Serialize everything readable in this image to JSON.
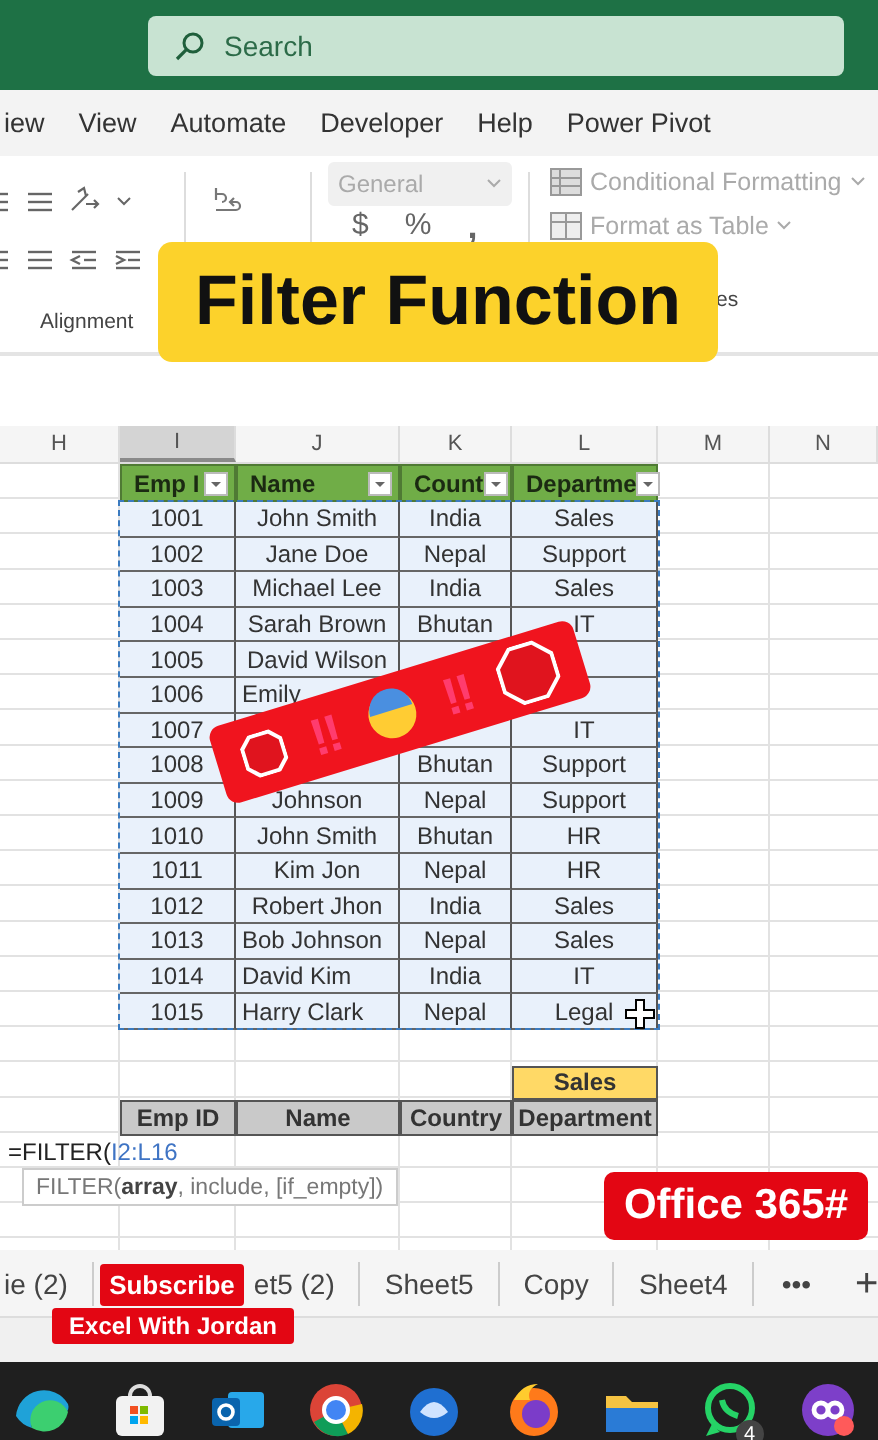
{
  "title_bar": {
    "search_placeholder": "Search"
  },
  "ribbon_tabs": [
    "iew",
    "View",
    "Automate",
    "Developer",
    "Help",
    "Power Pivot"
  ],
  "ribbon": {
    "number_format": "General",
    "number_symbols": [
      "$",
      "%",
      ","
    ],
    "conditional_formatting": "Conditional Formatting",
    "format_as_table": "Format as Table",
    "group_labels": [
      "Alignment",
      "es"
    ]
  },
  "banner": "Filter Function",
  "column_headers": [
    {
      "label": "H",
      "selected": false
    },
    {
      "label": "I",
      "selected": true
    },
    {
      "label": "J",
      "selected": false
    },
    {
      "label": "K",
      "selected": false
    },
    {
      "label": "L",
      "selected": false
    },
    {
      "label": "M",
      "selected": false
    },
    {
      "label": "N",
      "selected": false
    }
  ],
  "source_table": {
    "columns": [
      "Emp I",
      "Name",
      "Count",
      "Departme"
    ],
    "rows": [
      {
        "emp_id": "1001",
        "name": "John Smith",
        "left_aligned": false,
        "country": "India",
        "department": "Sales"
      },
      {
        "emp_id": "1002",
        "name": "Jane Doe",
        "left_aligned": false,
        "country": "Nepal",
        "department": "Support"
      },
      {
        "emp_id": "1003",
        "name": "Michael Lee",
        "left_aligned": false,
        "country": "India",
        "department": "Sales"
      },
      {
        "emp_id": "1004",
        "name": "Sarah Brown",
        "left_aligned": false,
        "country": "Bhutan",
        "department": "IT"
      },
      {
        "emp_id": "1005",
        "name": "David Wilson",
        "left_aligned": false
      },
      {
        "emp_id": "1006",
        "name": "Emily",
        "left_aligned": true
      },
      {
        "emp_id": "1007",
        "department": "IT"
      },
      {
        "emp_id": "1008",
        "country": "Bhutan",
        "department": "Support"
      },
      {
        "emp_id": "1009",
        "name": "Johnson",
        "left_aligned": false,
        "country": "Nepal",
        "department": "Support"
      },
      {
        "emp_id": "1010",
        "name": "John Smith",
        "left_aligned": false,
        "country": "Bhutan",
        "department": "HR"
      },
      {
        "emp_id": "1011",
        "name": "Kim Jon",
        "left_aligned": false,
        "country": "Nepal",
        "department": "HR"
      },
      {
        "emp_id": "1012",
        "name": "Robert Jhon",
        "left_aligned": false,
        "country": "India",
        "department": "Sales"
      },
      {
        "emp_id": "1013",
        "name": "Bob Johnson",
        "left_aligned": true,
        "country": "Nepal",
        "department": "Sales"
      },
      {
        "emp_id": "1014",
        "name": "David Kim",
        "left_aligned": true,
        "country": "India",
        "department": "IT"
      },
      {
        "emp_id": "1015",
        "name": "Harry Clark",
        "left_aligned": true,
        "country": "Nepal",
        "department": "Legal"
      }
    ]
  },
  "criteria": "Sales",
  "output_table": {
    "columns": [
      "Emp ID",
      "Name",
      "Country",
      "Department"
    ]
  },
  "formula": {
    "function": "=FILTER(",
    "range": "I2:L16"
  },
  "tooltip": "FILTER(**array**, include, [if_empty])",
  "sticker": {
    "marks": [
      "‼",
      "‼"
    ]
  },
  "office_badge": "Office 365#",
  "sheet_tabs": [
    {
      "label": "ie (2)",
      "selected": false
    },
    {
      "label": "et5 (2)",
      "selected": false
    },
    {
      "label": "Sheet5",
      "selected": false
    },
    {
      "label": "Copy",
      "selected": false
    },
    {
      "label": "Sheet4",
      "selected": false
    }
  ],
  "sheet_tab_buttons": [
    "•••",
    "+"
  ],
  "subscribe": {
    "line1": "Subscribe",
    "line2": "Excel With Jordan"
  },
  "taskbar": [
    {
      "kind": "swirl"
    },
    {
      "kind": "bag"
    },
    {
      "kind": "mail"
    },
    {
      "kind": "ring"
    },
    {
      "kind": "droplet"
    },
    {
      "kind": "flame"
    },
    {
      "kind": "folder"
    },
    {
      "kind": "chat",
      "badge": "4"
    },
    {
      "kind": "loop"
    }
  ]
}
